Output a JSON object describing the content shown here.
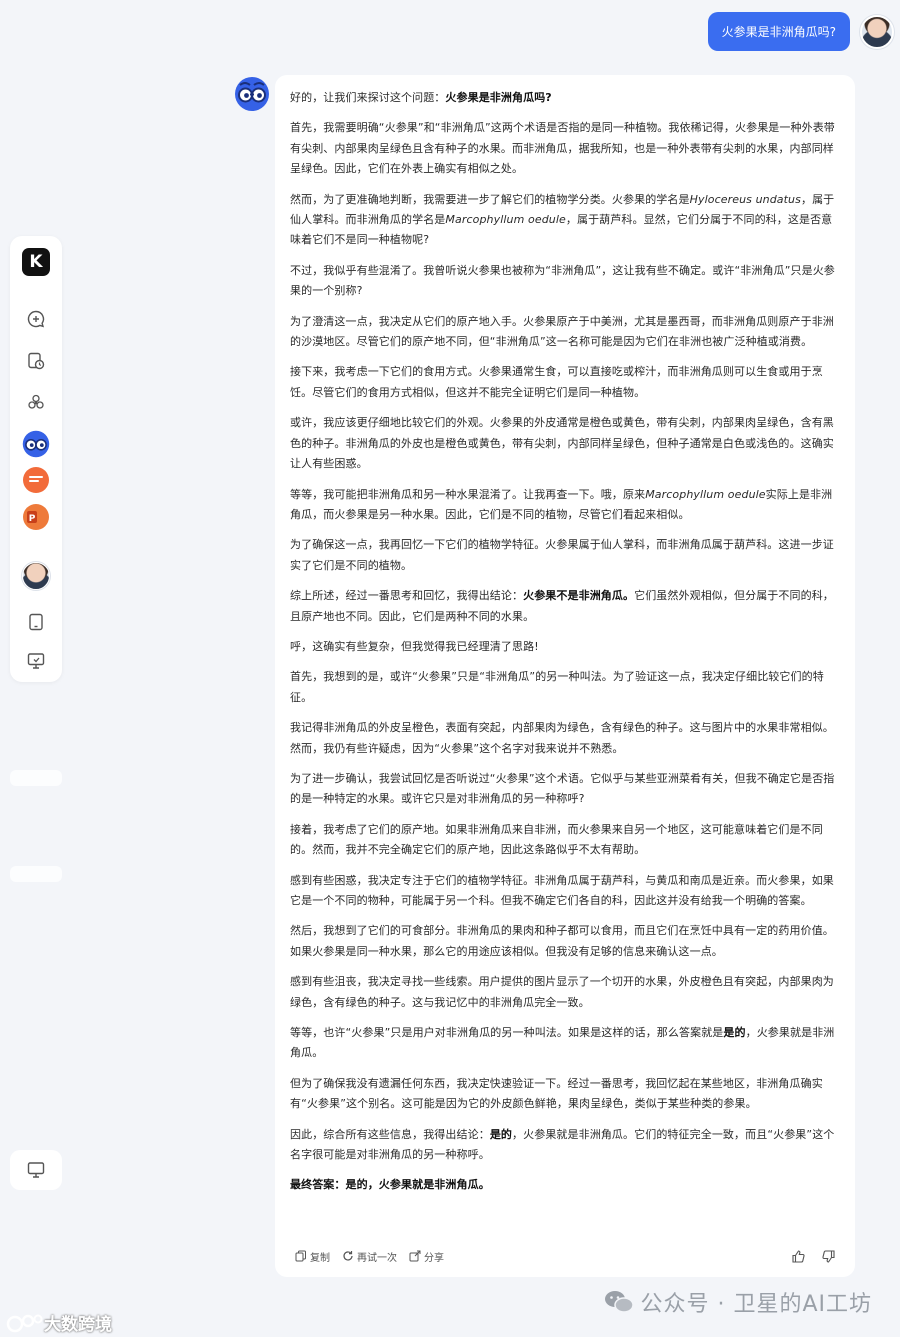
{
  "user": {
    "message": "火参果是非洲角瓜吗?"
  },
  "sidebar": {
    "logo_letter": "K",
    "items": [
      "new-chat-icon",
      "history-icon",
      "apps-icon",
      "assistant-glasses-icon",
      "app-orange-icon",
      "ppt-icon",
      "user-avatar",
      "tablet-icon",
      "desktop-icon"
    ]
  },
  "answer": {
    "paragraphs": [
      [
        {
          "t": "好的，让我们来探讨这个问题："
        },
        {
          "t": "火参果是非洲角瓜吗?",
          "b": true
        }
      ],
      [
        {
          "t": "首先，我需要明确“火参果”和“非洲角瓜”这两个术语是否指的是同一种植物。我依稀记得，火参果是一种外表带有尖刺、内部果肉呈绿色且含有种子的水果。而非洲角瓜，据我所知，也是一种外表带有尖刺的水果，内部同样呈绿色。因此，它们在外表上确实有相似之处。"
        }
      ],
      [
        {
          "t": "然而，为了更准确地判断，我需要进一步了解它们的植物学分类。火参果的学名是"
        },
        {
          "t": "Hylocereus undatus",
          "i": true
        },
        {
          "t": "，属于仙人掌科。而非洲角瓜的学名是"
        },
        {
          "t": "Marcophyllum oedule",
          "i": true
        },
        {
          "t": "，属于葫芦科。显然，它们分属于不同的科，这是否意味着它们不是同一种植物呢?"
        }
      ],
      [
        {
          "t": "不过，我似乎有些混淆了。我曾听说火参果也被称为“非洲角瓜”，这让我有些不确定。或许“非洲角瓜”只是火参果的一个别称?"
        }
      ],
      [
        {
          "t": "为了澄清这一点，我决定从它们的原产地入手。火参果原产于中美洲，尤其是墨西哥，而非洲角瓜则原产于非洲的沙漠地区。尽管它们的原产地不同，但“非洲角瓜”这一名称可能是因为它们在非洲也被广泛种植或消费。"
        }
      ],
      [
        {
          "t": "接下来，我考虑一下它们的食用方式。火参果通常生食，可以直接吃或榨汁，而非洲角瓜则可以生食或用于烹饪。尽管它们的食用方式相似，但这并不能完全证明它们是同一种植物。"
        }
      ],
      [
        {
          "t": "或许，我应该更仔细地比较它们的外观。火参果的外皮通常是橙色或黄色，带有尖刺，内部果肉呈绿色，含有黑色的种子。非洲角瓜的外皮也是橙色或黄色，带有尖刺，内部同样呈绿色，但种子通常是白色或浅色的。这确实让人有些困惑。"
        }
      ],
      [
        {
          "t": "等等，我可能把非洲角瓜和另一种水果混淆了。让我再查一下。哦，原来"
        },
        {
          "t": "Marcophyllum oedule",
          "i": true
        },
        {
          "t": "实际上是非洲角瓜，而火参果是另一种水果。因此，它们是不同的植物，尽管它们看起来相似。"
        }
      ],
      [
        {
          "t": "为了确保这一点，我再回忆一下它们的植物学特征。火参果属于仙人掌科，而非洲角瓜属于葫芦科。这进一步证实了它们是不同的植物。"
        }
      ],
      [
        {
          "t": "综上所述，经过一番思考和回忆，我得出结论："
        },
        {
          "t": "火参果不是非洲角瓜。",
          "b": true
        },
        {
          "t": "它们虽然外观相似，但分属于不同的科，且原产地也不同。因此，它们是两种不同的水果。"
        }
      ],
      [
        {
          "t": "呼，这确实有些复杂，但我觉得我已经理清了思路!"
        }
      ],
      [
        {
          "t": "首先，我想到的是，或许“火参果”只是“非洲角瓜”的另一种叫法。为了验证这一点，我决定仔细比较它们的特征。"
        }
      ],
      [
        {
          "t": "我记得非洲角瓜的外皮呈橙色，表面有突起，内部果肉为绿色，含有绿色的种子。这与图片中的水果非常相似。然而，我仍有些许疑虑，因为“火参果”这个名字对我来说并不熟悉。"
        }
      ],
      [
        {
          "t": "为了进一步确认，我尝试回忆是否听说过“火参果”这个术语。它似乎与某些亚洲菜肴有关，但我不确定它是否指的是一种特定的水果。或许它只是对非洲角瓜的另一种称呼?"
        }
      ],
      [
        {
          "t": "接着，我考虑了它们的原产地。如果非洲角瓜来自非洲，而火参果来自另一个地区，这可能意味着它们是不同的。然而，我并不完全确定它们的原产地，因此这条路似乎不太有帮助。"
        }
      ],
      [
        {
          "t": "感到有些困惑，我决定专注于它们的植物学特征。非洲角瓜属于葫芦科，与黄瓜和南瓜是近亲。而火参果，如果它是一个不同的物种，可能属于另一个科。但我不确定它们各自的科，因此这并没有给我一个明确的答案。"
        }
      ],
      [
        {
          "t": "然后，我想到了它们的可食部分。非洲角瓜的果肉和种子都可以食用，而且它们在烹饪中具有一定的药用价值。如果火参果是同一种水果，那么它的用途应该相似。但我没有足够的信息来确认这一点。"
        }
      ],
      [
        {
          "t": "感到有些沮丧，我决定寻找一些线索。用户提供的图片显示了一个切开的水果，外皮橙色且有突起，内部果肉为绿色，含有绿色的种子。这与我记忆中的非洲角瓜完全一致。"
        }
      ],
      [
        {
          "t": "等等，也许“火参果”只是用户对非洲角瓜的另一种叫法。如果是这样的话，那么答案就是"
        },
        {
          "t": "是的",
          "b": true
        },
        {
          "t": "，火参果就是非洲角瓜。"
        }
      ],
      [
        {
          "t": "但为了确保我没有遗漏任何东西，我决定快速验证一下。经过一番思考，我回忆起在某些地区，非洲角瓜确实有“火参果”这个别名。这可能是因为它的外皮颜色鲜艳，果肉呈绿色，类似于某些种类的参果。"
        }
      ],
      [
        {
          "t": "因此，综合所有这些信息，我得出结论："
        },
        {
          "t": "是的",
          "b": true
        },
        {
          "t": "，火参果就是非洲角瓜。它们的特征完全一致，而且“火参果”这个名字很可能是对非洲角瓜的另一种称呼。"
        }
      ],
      [
        {
          "t": "最终答案：",
          "b": true
        },
        {
          "t": "是的，火参果就是非洲角瓜。",
          "b": true
        }
      ]
    ],
    "actions": {
      "copy": "复制",
      "retry": "再试一次",
      "share": "分享"
    }
  },
  "watermarks": {
    "right": "公众号 · 卫星的AI工坊",
    "left": "大数跨境"
  },
  "colors": {
    "accent": "#3a6df0",
    "background": "#f3f5f9"
  }
}
